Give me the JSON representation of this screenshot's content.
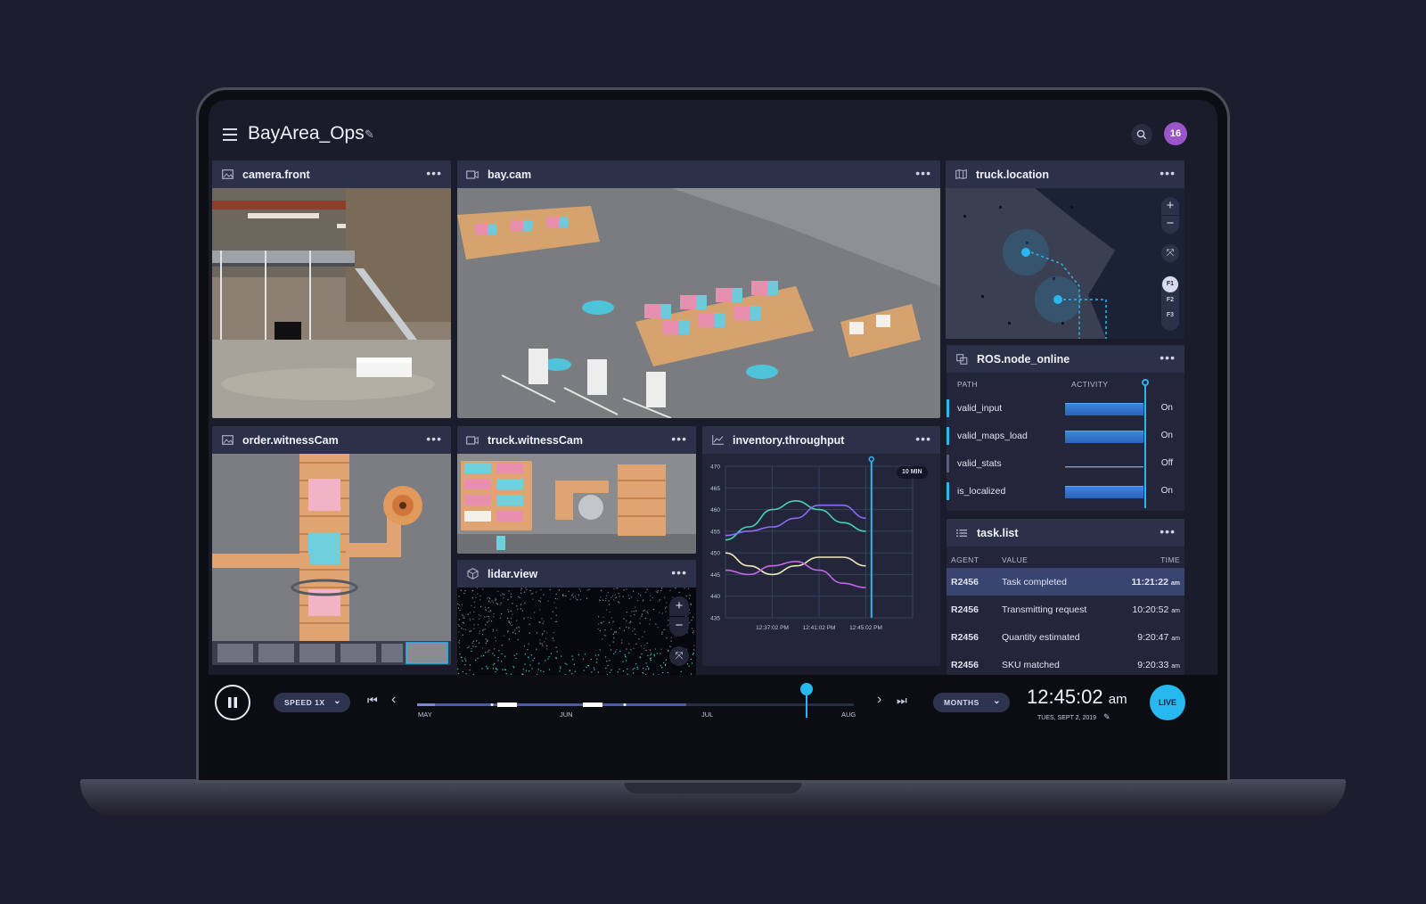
{
  "header": {
    "title": "BayArea_Ops",
    "avatar_count": "16"
  },
  "panels": {
    "camera_front": {
      "title": "camera.front"
    },
    "bay_cam": {
      "title": "bay.cam"
    },
    "truck_location": {
      "title": "truck.location",
      "floors": [
        "F1",
        "F2",
        "F3"
      ]
    },
    "order_witness": {
      "title": "order.witnessCam"
    },
    "truck_witness": {
      "title": "truck.witnessCam"
    },
    "lidar": {
      "title": "lidar.view"
    },
    "inventory": {
      "title": "inventory.throughput",
      "window_badge": "10 MIN"
    },
    "ros": {
      "title": "ROS.node_online",
      "col_path": "PATH",
      "col_activity": "ACTIVITY",
      "rows": [
        {
          "path": "valid_input",
          "state": "On",
          "active": true
        },
        {
          "path": "valid_maps_load",
          "state": "On",
          "active": true
        },
        {
          "path": "valid_stats",
          "state": "Off",
          "active": false
        },
        {
          "path": "is_localized",
          "state": "On",
          "active": true
        }
      ]
    },
    "tasks": {
      "title": "task.list",
      "col_agent": "AGENT",
      "col_value": "VALUE",
      "col_time": "TIME",
      "rows": [
        {
          "agent": "R2456",
          "value": "Task completed",
          "time": "11:21:22",
          "ampm": "am",
          "selected": true
        },
        {
          "agent": "R2456",
          "value": "Transmitting request",
          "time": "10:20:52",
          "ampm": "am",
          "selected": false
        },
        {
          "agent": "R2456",
          "value": "Quantity estimated",
          "time": "9:20:47",
          "ampm": "am",
          "selected": false
        },
        {
          "agent": "R2456",
          "value": "SKU matched",
          "time": "9:20:33",
          "ampm": "am",
          "selected": false
        }
      ]
    }
  },
  "chart_data": {
    "type": "line",
    "title": "",
    "ylim": [
      435,
      470
    ],
    "yticks": [
      470,
      465,
      460,
      455,
      450,
      445,
      440,
      435
    ],
    "x": [
      0,
      1,
      2,
      3,
      4,
      5,
      6,
      7,
      8
    ],
    "xtick_labels": [
      "12:37:02 PM",
      "12:41:02 PM",
      "12:45:02 PM"
    ],
    "series": [
      {
        "color": "#46d3b4",
        "values": [
          453,
          456,
          460,
          462,
          460,
          457,
          455,
          454,
          454
        ]
      },
      {
        "color": "#8d6bff",
        "values": [
          454,
          455,
          456,
          458,
          461,
          461,
          458,
          455,
          453
        ]
      },
      {
        "color": "#f1e8b8",
        "values": [
          450,
          447,
          445,
          447,
          449,
          449,
          447,
          446,
          450
        ]
      },
      {
        "color": "#c466e6",
        "values": [
          446,
          445,
          447,
          448,
          446,
          443,
          442,
          444,
          449
        ]
      }
    ]
  },
  "playbar": {
    "speed": "SPEED 1X",
    "months": [
      "MAY",
      "JUN",
      "JUL",
      "AUG"
    ],
    "period": "MONTHS",
    "time": "12:45:02",
    "ampm": "am",
    "date": "TUES, SEPT 2, 2019",
    "live": "LIVE"
  },
  "colors": {
    "accent": "#27b8f0",
    "avatar": "#9a56c8",
    "panel": "#23263a",
    "panel_head": "#2c3049"
  }
}
